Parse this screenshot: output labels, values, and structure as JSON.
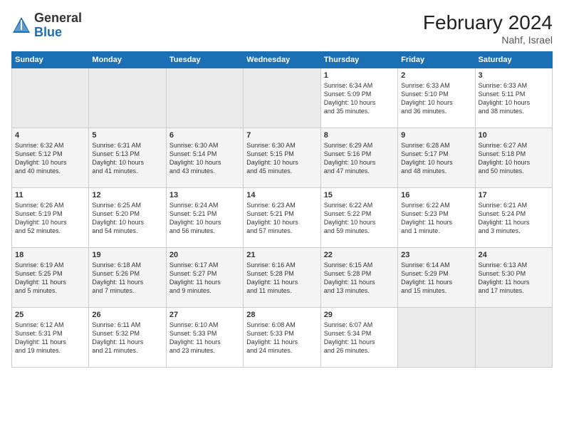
{
  "logo": {
    "general": "General",
    "blue": "Blue"
  },
  "header": {
    "month_year": "February 2024",
    "location": "Nahf, Israel"
  },
  "days_of_week": [
    "Sunday",
    "Monday",
    "Tuesday",
    "Wednesday",
    "Thursday",
    "Friday",
    "Saturday"
  ],
  "weeks": [
    [
      {
        "day": "",
        "info": ""
      },
      {
        "day": "",
        "info": ""
      },
      {
        "day": "",
        "info": ""
      },
      {
        "day": "",
        "info": ""
      },
      {
        "day": "1",
        "info": "Sunrise: 6:34 AM\nSunset: 5:09 PM\nDaylight: 10 hours\nand 35 minutes."
      },
      {
        "day": "2",
        "info": "Sunrise: 6:33 AM\nSunset: 5:10 PM\nDaylight: 10 hours\nand 36 minutes."
      },
      {
        "day": "3",
        "info": "Sunrise: 6:33 AM\nSunset: 5:11 PM\nDaylight: 10 hours\nand 38 minutes."
      }
    ],
    [
      {
        "day": "4",
        "info": "Sunrise: 6:32 AM\nSunset: 5:12 PM\nDaylight: 10 hours\nand 40 minutes."
      },
      {
        "day": "5",
        "info": "Sunrise: 6:31 AM\nSunset: 5:13 PM\nDaylight: 10 hours\nand 41 minutes."
      },
      {
        "day": "6",
        "info": "Sunrise: 6:30 AM\nSunset: 5:14 PM\nDaylight: 10 hours\nand 43 minutes."
      },
      {
        "day": "7",
        "info": "Sunrise: 6:30 AM\nSunset: 5:15 PM\nDaylight: 10 hours\nand 45 minutes."
      },
      {
        "day": "8",
        "info": "Sunrise: 6:29 AM\nSunset: 5:16 PM\nDaylight: 10 hours\nand 47 minutes."
      },
      {
        "day": "9",
        "info": "Sunrise: 6:28 AM\nSunset: 5:17 PM\nDaylight: 10 hours\nand 48 minutes."
      },
      {
        "day": "10",
        "info": "Sunrise: 6:27 AM\nSunset: 5:18 PM\nDaylight: 10 hours\nand 50 minutes."
      }
    ],
    [
      {
        "day": "11",
        "info": "Sunrise: 6:26 AM\nSunset: 5:19 PM\nDaylight: 10 hours\nand 52 minutes."
      },
      {
        "day": "12",
        "info": "Sunrise: 6:25 AM\nSunset: 5:20 PM\nDaylight: 10 hours\nand 54 minutes."
      },
      {
        "day": "13",
        "info": "Sunrise: 6:24 AM\nSunset: 5:21 PM\nDaylight: 10 hours\nand 56 minutes."
      },
      {
        "day": "14",
        "info": "Sunrise: 6:23 AM\nSunset: 5:21 PM\nDaylight: 10 hours\nand 57 minutes."
      },
      {
        "day": "15",
        "info": "Sunrise: 6:22 AM\nSunset: 5:22 PM\nDaylight: 10 hours\nand 59 minutes."
      },
      {
        "day": "16",
        "info": "Sunrise: 6:22 AM\nSunset: 5:23 PM\nDaylight: 11 hours\nand 1 minute."
      },
      {
        "day": "17",
        "info": "Sunrise: 6:21 AM\nSunset: 5:24 PM\nDaylight: 11 hours\nand 3 minutes."
      }
    ],
    [
      {
        "day": "18",
        "info": "Sunrise: 6:19 AM\nSunset: 5:25 PM\nDaylight: 11 hours\nand 5 minutes."
      },
      {
        "day": "19",
        "info": "Sunrise: 6:18 AM\nSunset: 5:26 PM\nDaylight: 11 hours\nand 7 minutes."
      },
      {
        "day": "20",
        "info": "Sunrise: 6:17 AM\nSunset: 5:27 PM\nDaylight: 11 hours\nand 9 minutes."
      },
      {
        "day": "21",
        "info": "Sunrise: 6:16 AM\nSunset: 5:28 PM\nDaylight: 11 hours\nand 11 minutes."
      },
      {
        "day": "22",
        "info": "Sunrise: 6:15 AM\nSunset: 5:28 PM\nDaylight: 11 hours\nand 13 minutes."
      },
      {
        "day": "23",
        "info": "Sunrise: 6:14 AM\nSunset: 5:29 PM\nDaylight: 11 hours\nand 15 minutes."
      },
      {
        "day": "24",
        "info": "Sunrise: 6:13 AM\nSunset: 5:30 PM\nDaylight: 11 hours\nand 17 minutes."
      }
    ],
    [
      {
        "day": "25",
        "info": "Sunrise: 6:12 AM\nSunset: 5:31 PM\nDaylight: 11 hours\nand 19 minutes."
      },
      {
        "day": "26",
        "info": "Sunrise: 6:11 AM\nSunset: 5:32 PM\nDaylight: 11 hours\nand 21 minutes."
      },
      {
        "day": "27",
        "info": "Sunrise: 6:10 AM\nSunset: 5:33 PM\nDaylight: 11 hours\nand 23 minutes."
      },
      {
        "day": "28",
        "info": "Sunrise: 6:08 AM\nSunset: 5:33 PM\nDaylight: 11 hours\nand 24 minutes."
      },
      {
        "day": "29",
        "info": "Sunrise: 6:07 AM\nSunset: 5:34 PM\nDaylight: 11 hours\nand 26 minutes."
      },
      {
        "day": "",
        "info": ""
      },
      {
        "day": "",
        "info": ""
      }
    ]
  ]
}
